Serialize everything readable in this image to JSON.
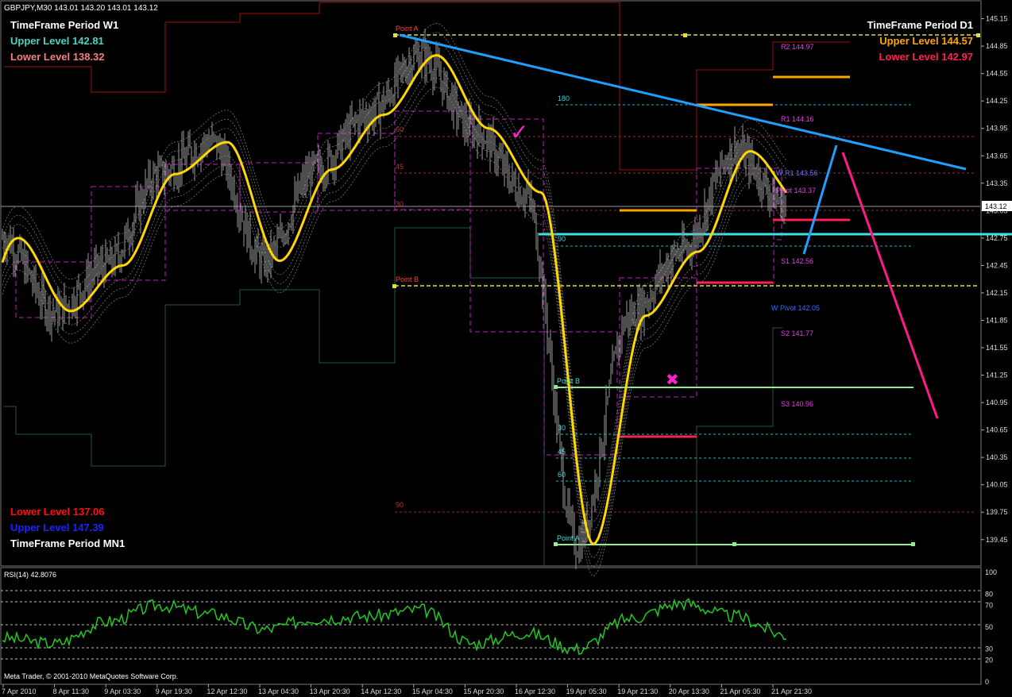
{
  "header": {
    "symbol_line": "GBPJPY,M30  143.01 143.20 143.01 143.12"
  },
  "w1": {
    "title": "TimeFrame Period W1",
    "upper": "Upper Level 142.81",
    "lower": "Lower Level 138.32"
  },
  "d1": {
    "title": "TimeFrame Period D1",
    "upper": "Upper Level 144.57",
    "lower": "Lower Level 142.97"
  },
  "mn1": {
    "lower": "Lower Level 137.06",
    "upper": "Upper Level 147.39",
    "title": "TimeFrame Period MN1"
  },
  "colors": {
    "w1_upper": "#4fd1c5",
    "w1_lower": "#f08080",
    "d1_upper": "#ffa500",
    "d1_lower": "#ff2050",
    "mn1_lower": "#ff1010",
    "mn1_upper": "#2020ff",
    "ma": "#ffd700",
    "rsi": "#22c822",
    "trend_blue": "#1fa0ff",
    "trend_pink": "#ff1a8c",
    "cyan_level": "#40e0e0"
  },
  "price_axis": {
    "min": 139.17,
    "max": 145.32,
    "ticks": [
      "145.15",
      "144.85",
      "144.55",
      "144.25",
      "143.95",
      "143.65",
      "143.35",
      "143.05",
      "142.75",
      "142.45",
      "142.15",
      "141.85",
      "141.55",
      "141.25",
      "140.95",
      "140.65",
      "140.35",
      "140.05",
      "139.75",
      "139.45"
    ],
    "current": "143.12"
  },
  "pivots": {
    "r2": "R2 144.97",
    "r1": "R1 144.16",
    "wr1": "W R1 143.56",
    "pivot": "Pivot 143.37",
    "s1": "S1 142.56",
    "wpivot": "W Pivot 142.05",
    "s2": "S2 141.77",
    "s3": "S3 140.96"
  },
  "points": {
    "a_top": "Point A",
    "b_mid": "Point B",
    "b_low": "Point B",
    "a_low": "Point A"
  },
  "fib_labels": {
    "red": [
      "60",
      "45",
      "30",
      "90"
    ],
    "cyan": [
      "180",
      "90",
      "30",
      "45",
      "60"
    ]
  },
  "marks": {
    "check": "✓",
    "cross": "✖"
  },
  "rsi": {
    "title": "RSI(14) 42.8076",
    "ticks": [
      "100",
      "80",
      "70",
      "50",
      "30",
      "20",
      "0"
    ]
  },
  "time_axis": [
    "7 Apr 2010",
    "8 Apr 11:30",
    "9 Apr 03:30",
    "9 Apr 19:30",
    "12 Apr 12:30",
    "13 Apr 04:30",
    "13 Apr 20:30",
    "14 Apr 12:30",
    "15 Apr 04:30",
    "15 Apr 20:30",
    "16 Apr 12:30",
    "19 Apr 05:30",
    "19 Apr 21:30",
    "20 Apr 13:30",
    "21 Apr 05:30",
    "21 Apr 21:30"
  ],
  "copyright": "Meta Trader, © 2001-2010 MetaQuotes Software Corp.",
  "chart_data": {
    "type": "line",
    "title": "GBPJPY,M30",
    "x": [
      "7 Apr 2010",
      "8 Apr 11:30",
      "9 Apr 03:30",
      "9 Apr 19:30",
      "12 Apr 12:30",
      "13 Apr 04:30",
      "13 Apr 20:30",
      "14 Apr 12:30",
      "15 Apr 04:30",
      "15 Apr 20:30",
      "16 Apr 12:30",
      "19 Apr 05:30",
      "19 Apr 21:30",
      "20 Apr 13:30",
      "21 Apr 05:30",
      "21 Apr 21:30"
    ],
    "series": [
      {
        "values": [
          142.75,
          141.95,
          142.45,
          143.45,
          143.8,
          142.5,
          143.5,
          144.1,
          144.75,
          143.95,
          143.25,
          139.4,
          141.9,
          142.6,
          143.7,
          143.12
        ]
      }
    ],
    "ylim": [
      139.17,
      145.32
    ],
    "rsi_values": [
      40,
      35,
      55,
      70,
      62,
      48,
      58,
      60,
      66,
      35,
      45,
      30,
      58,
      72,
      60,
      42.8
    ],
    "rsi_ylim": [
      0,
      100
    ]
  }
}
